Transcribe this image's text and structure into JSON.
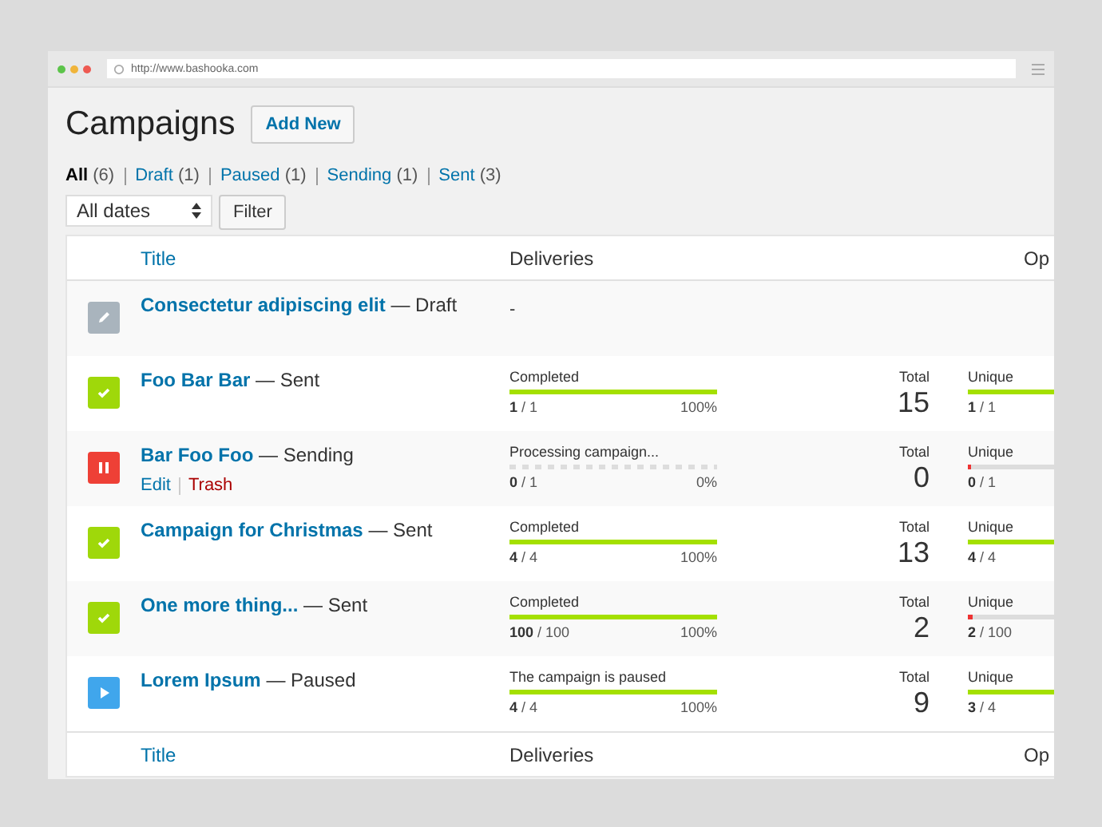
{
  "browser": {
    "url": "http://www.bashooka.com"
  },
  "page": {
    "title": "Campaigns",
    "add_button": "Add New"
  },
  "filters": [
    {
      "label": "All",
      "count": "(6)",
      "selected": true
    },
    {
      "label": "Draft",
      "count": "(1)",
      "selected": false
    },
    {
      "label": "Paused",
      "count": "(1)",
      "selected": false
    },
    {
      "label": "Sending",
      "count": "(1)",
      "selected": false
    },
    {
      "label": "Sent",
      "count": "(3)",
      "selected": false
    }
  ],
  "date_select": {
    "value": "All dates"
  },
  "filter_button": "Filter",
  "table": {
    "columns": [
      "Title",
      "Deliveries",
      "Op"
    ],
    "rows": [
      {
        "kind": "draft",
        "title": "Consectetur adipiscing elit",
        "state": "— Draft",
        "deliveries_text": "-"
      },
      {
        "kind": "sent",
        "title": "Foo Bar Bar",
        "state": "— Sent",
        "delivery": {
          "kind": "solid",
          "label": "Completed",
          "done": "1",
          "of": "/ 1",
          "percent": "100%",
          "level": 1
        },
        "total_label": "Total",
        "total": "15",
        "unique": {
          "label": "Unique",
          "done": "1",
          "of": "/ 1",
          "level": 1
        }
      },
      {
        "kind": "sending",
        "title": "Bar Foo Foo",
        "state": "— Sending",
        "actions": [
          {
            "label": "Edit",
            "kind": "edit"
          },
          {
            "label": "Trash",
            "kind": "trash"
          }
        ],
        "delivery": {
          "kind": "dashed",
          "label": "Processing campaign...",
          "done": "0",
          "of": "/ 1",
          "percent": "0%",
          "level": 0
        },
        "total_label": "Total",
        "total": "0",
        "unique": {
          "label": "Unique",
          "done": "0",
          "of": "/ 1",
          "level": 0
        }
      },
      {
        "kind": "sent",
        "title": "Campaign for Christmas",
        "state": "— Sent",
        "delivery": {
          "kind": "solid",
          "label": "Completed",
          "done": "4",
          "of": "/ 4",
          "percent": "100%",
          "level": 1
        },
        "total_label": "Total",
        "total": "13",
        "unique": {
          "label": "Unique",
          "done": "4",
          "of": "/ 4",
          "level": 1
        }
      },
      {
        "kind": "sent",
        "title": "One more thing...",
        "state": "— Sent",
        "delivery": {
          "kind": "solid",
          "label": "Completed",
          "done": "100",
          "of": "/ 100",
          "percent": "100%",
          "level": 1
        },
        "total_label": "Total",
        "total": "2",
        "unique": {
          "label": "Unique",
          "done": "2",
          "of": "/ 100",
          "level": 0.02
        }
      },
      {
        "kind": "paused",
        "title": "Lorem Ipsum",
        "state": "— Paused",
        "delivery": {
          "kind": "solid",
          "label": "The campaign is paused",
          "done": "4",
          "of": "/ 4",
          "percent": "100%",
          "level": 1
        },
        "total_label": "Total",
        "total": "9",
        "unique": {
          "label": "Unique",
          "done": "3",
          "of": "/ 4",
          "level": 0.75
        }
      }
    ],
    "footer_columns": [
      "Title",
      "Deliveries",
      "Op"
    ]
  }
}
